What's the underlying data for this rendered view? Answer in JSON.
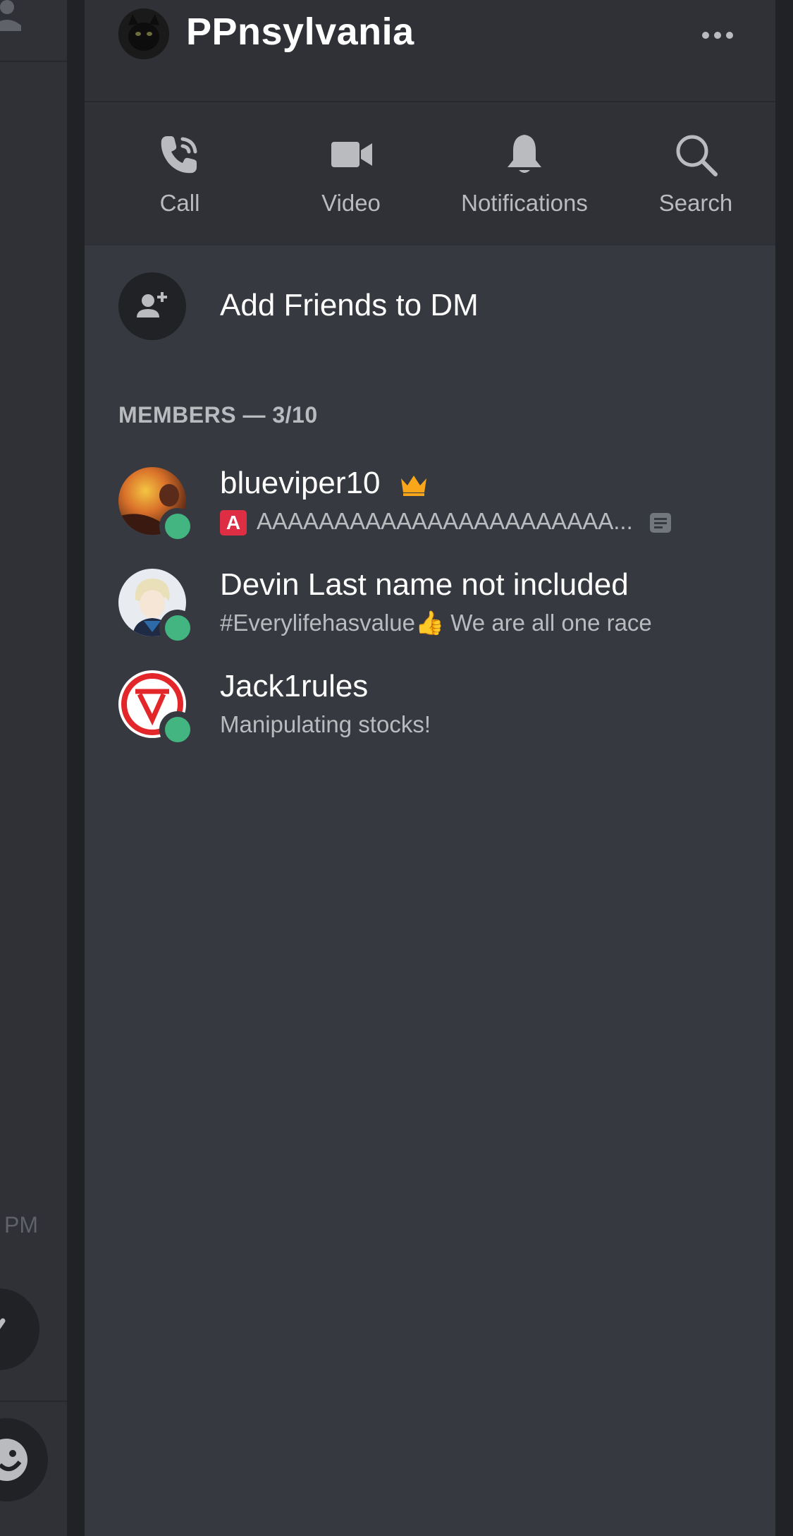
{
  "left_peek": {
    "time_fragment": "PM"
  },
  "header": {
    "title": "PPnsylvania"
  },
  "actions": [
    {
      "label": "Call",
      "icon": "phone-call-icon"
    },
    {
      "label": "Video",
      "icon": "video-camera-icon"
    },
    {
      "label": "Notifications",
      "icon": "bell-icon"
    },
    {
      "label": "Search",
      "icon": "search-icon"
    }
  ],
  "add_friends": {
    "label": "Add Friends to DM",
    "icon": "add-person-icon"
  },
  "members": {
    "header": "MEMBERS — 3/10",
    "list": [
      {
        "name": "blueviper10",
        "is_owner": true,
        "status_emoji": "🅰",
        "status": "AAAAAAAAAAAAAAAAAAAAAAA...",
        "presence": "online"
      },
      {
        "name": "Devin Last name not included",
        "status": "#Everylifehasvalue👍 We are all one race",
        "presence": "online"
      },
      {
        "name": "Jack1rules",
        "status": "Manipulating stocks!",
        "presence": "online"
      }
    ]
  },
  "colors": {
    "background": "#36393f",
    "header_bg": "#2f3136",
    "online": "#43b581",
    "crown": "#faa61a",
    "muted_text": "#b9bbbe"
  }
}
